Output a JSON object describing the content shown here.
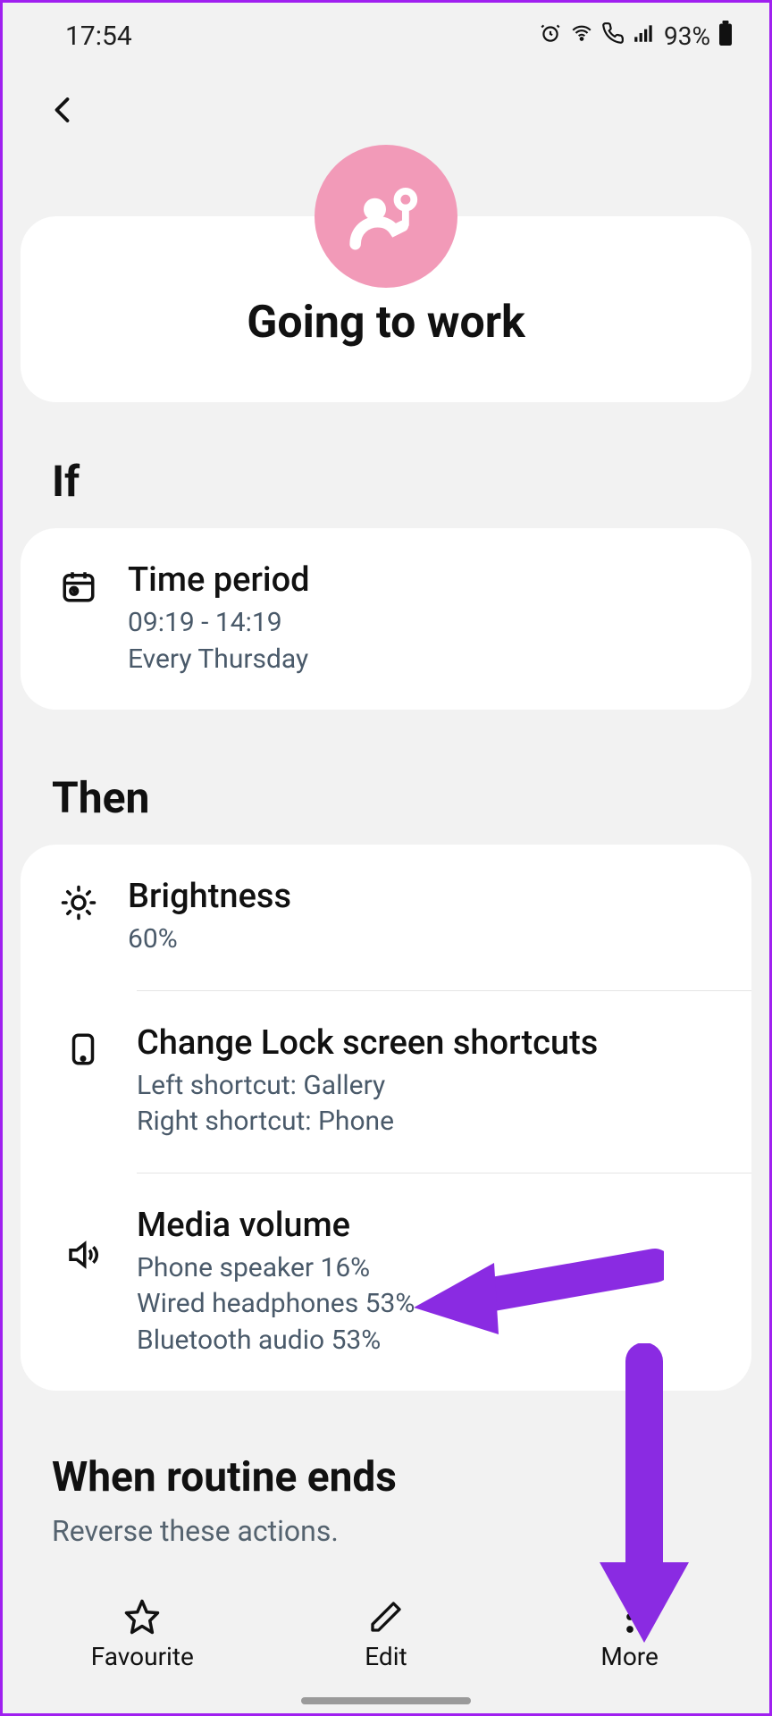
{
  "status": {
    "time": "17:54",
    "battery": "93%"
  },
  "routine": {
    "title": "Going to work"
  },
  "sections": {
    "if_label": "If",
    "then_label": "Then",
    "ends_label": "When routine ends",
    "ends_sub": "Reverse these actions."
  },
  "if_items": [
    {
      "title": "Time period",
      "sub1": "09:19 - 14:19",
      "sub2": "Every Thursday"
    }
  ],
  "then_items": [
    {
      "title": "Brightness",
      "sub1": "60%"
    },
    {
      "title": "Change Lock screen shortcuts",
      "sub1": "Left shortcut: Gallery",
      "sub2": "Right shortcut: Phone"
    },
    {
      "title": "Media volume",
      "sub1": "Phone speaker 16%",
      "sub2": "Wired headphones 53%",
      "sub3": "Bluetooth audio 53%"
    }
  ],
  "bottom": {
    "favourite": "Favourite",
    "edit": "Edit",
    "more": "More"
  }
}
